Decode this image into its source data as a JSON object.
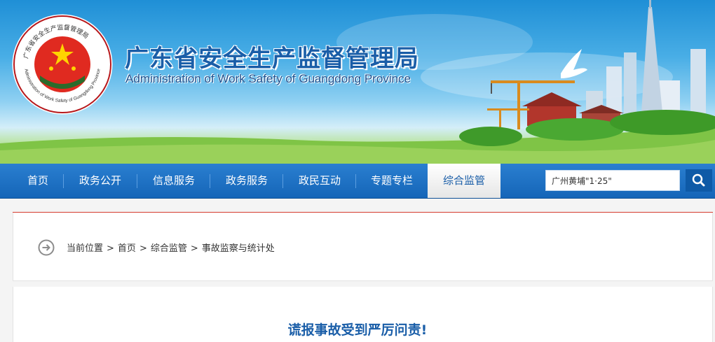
{
  "header": {
    "title_zh": "广东省安全生产监督管理局",
    "title_en": "Administration of Work Safety of Guangdong Province",
    "seal_text_top": "广东省安全生产监督管理局",
    "seal_text_bottom": "Administration of Work Safety of Guangdong Province"
  },
  "nav": {
    "items": [
      {
        "label": "首页"
      },
      {
        "label": "政务公开"
      },
      {
        "label": "信息服务"
      },
      {
        "label": "政务服务"
      },
      {
        "label": "政民互动"
      },
      {
        "label": "专题专栏"
      },
      {
        "label": "综合监管"
      }
    ],
    "active": "综合监管"
  },
  "search": {
    "value": "广州黄埔\"1·25\"",
    "button_icon": "search-icon"
  },
  "breadcrumb": {
    "prefix": "当前位置",
    "items": [
      "首页",
      "综合监管",
      "事故监察与统计处"
    ],
    "separator": ">"
  },
  "article": {
    "title": "谎报事故受到严厉问责!"
  },
  "colors": {
    "nav_blue": "#1565b8",
    "title_blue": "#1a5ea8",
    "accent_red": "#d53b2e"
  }
}
